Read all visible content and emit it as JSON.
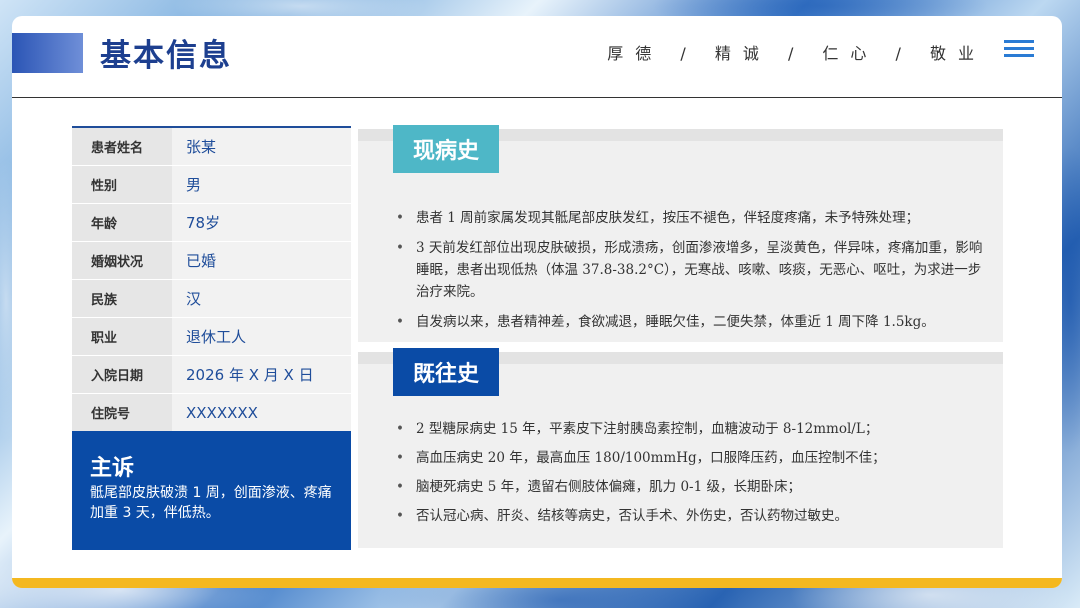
{
  "header": {
    "title": "基本信息",
    "motto": "厚德 / 精诚 / 仁心 / 敬业",
    "menu_icon": "hamburger-icon"
  },
  "patient_info": [
    {
      "label": "患者姓名",
      "value": "张某"
    },
    {
      "label": "性别",
      "value": "男"
    },
    {
      "label": "年龄",
      "value": "78岁"
    },
    {
      "label": "婚姻状况",
      "value": "已婚"
    },
    {
      "label": "民族",
      "value": "汉"
    },
    {
      "label": "职业",
      "value": "退休工人"
    },
    {
      "label": "入院日期",
      "value": "2026 年 X 月 X 日"
    },
    {
      "label": "住院号",
      "value": "XXXXXXX"
    }
  ],
  "complaint": {
    "heading": "主诉",
    "text": "骶尾部皮肤破溃 1 周，创面渗液、疼痛加重 3 天，伴低热。"
  },
  "present_history": {
    "heading": "现病史",
    "items": [
      "患者 1 周前家属发现其骶尾部皮肤发红，按压不褪色，伴轻度疼痛，未予特殊处理；",
      "3 天前发红部位出现皮肤破损，形成溃疡，创面渗液增多，呈淡黄色，伴异味，疼痛加重，影响睡眠，患者出现低热（体温 37.8-38.2°C），无寒战、咳嗽、咳痰，无恶心、呕吐，为求进一步治疗来院。",
      "自发病以来，患者精神差，食欲减退，睡眠欠佳，二便失禁，体重近 1 周下降 1.5kg。"
    ]
  },
  "past_history": {
    "heading": "既往史",
    "items": [
      "2 型糖尿病史 15 年，平素皮下注射胰岛素控制，血糖波动于 8-12mmol/L；",
      "高血压病史 20 年，最高血压 180/100mmHg，口服降压药，血压控制不佳；",
      "脑梗死病史 5 年，遗留右侧肢体偏瘫，肌力 0-1 级，长期卧床；",
      "否认冠心病、肝炎、结核等病史，否认手术、外伤史，否认药物过敏史。"
    ]
  },
  "colors": {
    "primary": "#0a4ba6",
    "teal": "#4eb7c7",
    "accent_yellow": "#f4b820",
    "title": "#1d3f8f"
  }
}
